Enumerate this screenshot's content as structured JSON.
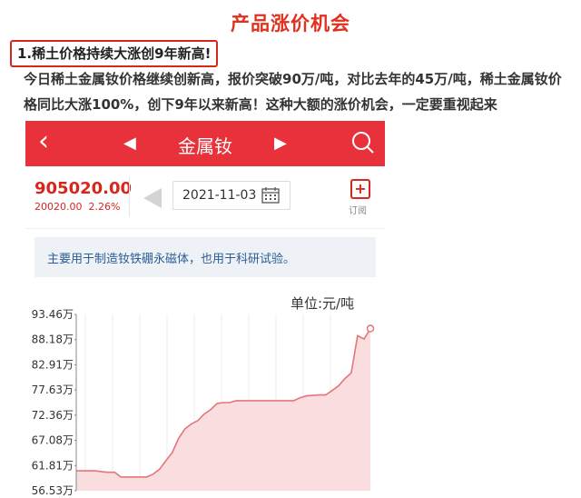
{
  "article": {
    "title": "产品涨价机会",
    "subhead": "1.稀土价格持续大涨创9年新高!",
    "paragraph": "今日稀土金属钕价格继续创新高，报价突破90万/吨，对比去年的45万/吨，稀土金属钕价格同比大涨100%，创下9年以来新高！这种大额的涨价机会，一定要重视起来"
  },
  "app": {
    "nav_title": "金属钕",
    "back_icon": "back-chevron-icon",
    "search_icon": "search-icon",
    "price": "905020.00",
    "change_value": "20020.00",
    "change_pct": "2.26%",
    "date": "2021-11-03",
    "subscribe_label": "订阅",
    "info_text": "主要用于制造钕铁硼永磁体，也用于科研试验。",
    "unit_label": "单位:元/吨",
    "accent_color": "#e8313a",
    "up_color": "#d9261c"
  },
  "chart_data": {
    "type": "area",
    "title": "",
    "xlabel": "",
    "ylabel": "",
    "ylim": [
      56.53,
      93.46
    ],
    "y_tick_labels": [
      "93.46万",
      "88.18万",
      "82.91万",
      "77.63万",
      "72.36万",
      "67.08万",
      "61.81万",
      "56.53万"
    ],
    "grid": "vertical",
    "series": [
      {
        "values": [
          60.7,
          60.7,
          60.7,
          60.7,
          60.5,
          60.4,
          60.4,
          59.4,
          59.4,
          59.4,
          59.4,
          59.4,
          60.0,
          61.0,
          62.8,
          64.5,
          67.5,
          69.5,
          70.5,
          71.2,
          72.6,
          73.5,
          74.8,
          75.0,
          75.0,
          75.4,
          75.4,
          75.4,
          75.4,
          75.4,
          75.4,
          75.4,
          75.4,
          75.4,
          75.4,
          76.0,
          76.4,
          76.5,
          76.6,
          76.6,
          77.5,
          78.5,
          80.0,
          81.2,
          89.0,
          88.3,
          90.5
        ]
      }
    ],
    "line_color": "#e5757a",
    "fill_color": "#f9dddf"
  }
}
